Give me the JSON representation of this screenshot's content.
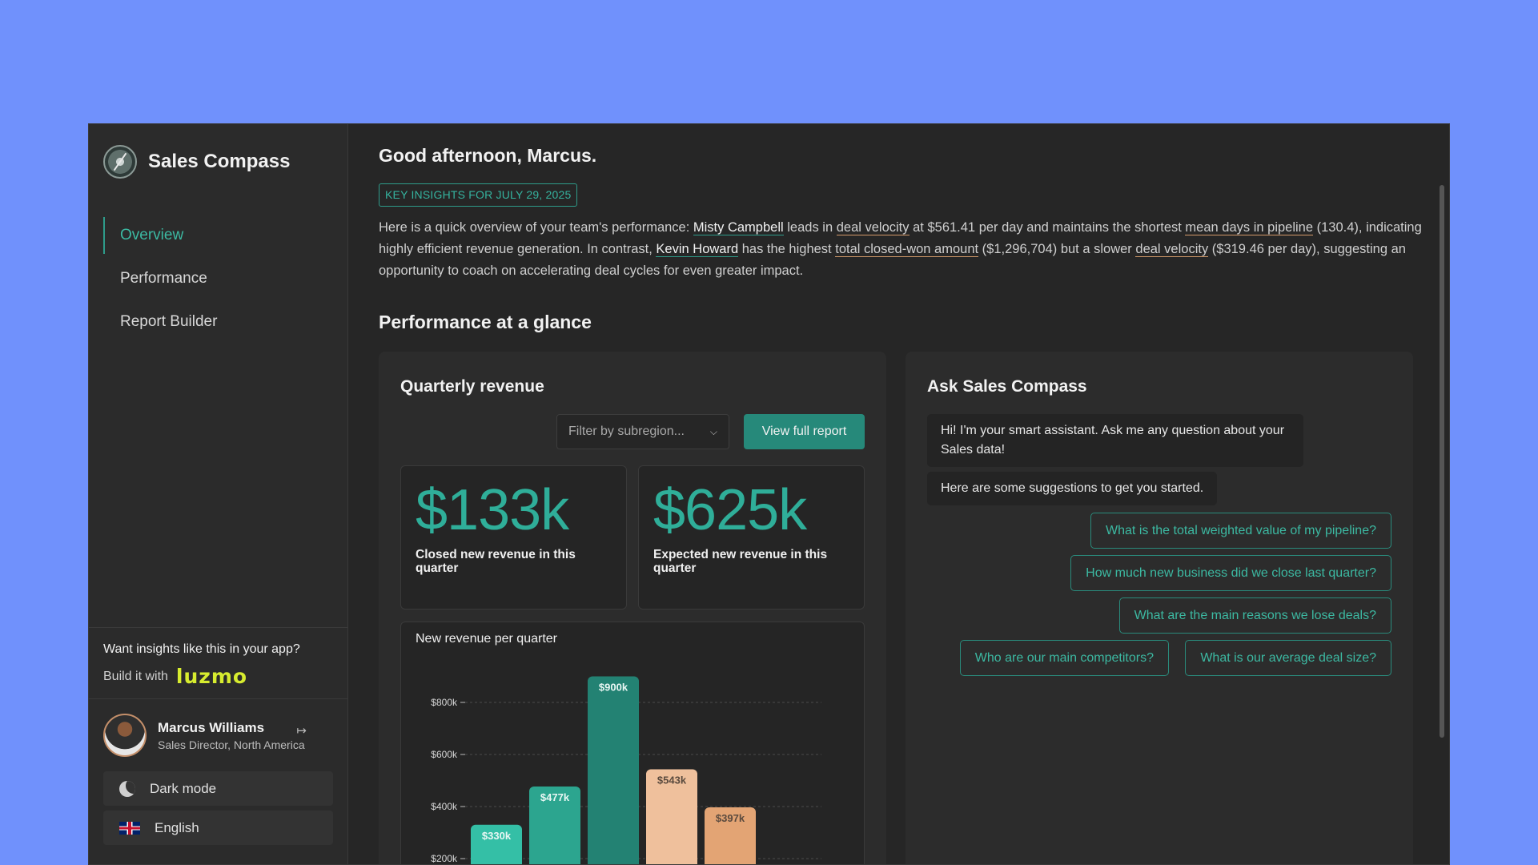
{
  "app": {
    "brand_name": "Sales Compass"
  },
  "sidebar": {
    "nav": [
      {
        "label": "Overview",
        "active": true
      },
      {
        "label": "Performance",
        "active": false
      },
      {
        "label": "Report Builder",
        "active": false
      }
    ],
    "promo_question": "Want insights like this in your app?",
    "promo_build": "Build it with",
    "promo_brand": "luzmo",
    "user": {
      "name": "Marcus Williams",
      "role": "Sales Director, North America"
    },
    "dark_mode_label": "Dark mode",
    "language_label": "English"
  },
  "main": {
    "greeting": "Good afternoon, Marcus.",
    "insights_badge": "KEY INSIGHTS FOR JULY 29, 2025",
    "summary": {
      "p1": "Here is a quick overview of your team's performance: ",
      "name1": "Misty Campbell",
      "p2": " leads in ",
      "m1": "deal velocity",
      "p3": " at $561.41 per day and maintains the shortest ",
      "m2": "mean days in pipeline",
      "p4": " (130.4), indicating highly efficient revenue generation. In contrast, ",
      "name2": "Kevin Howard",
      "p5": " has the highest ",
      "m3": "total closed-won amount",
      "p6": " ($1,296,704) but a slower ",
      "m4": "deal velocity",
      "p7": " ($319.46 per day), suggesting an opportunity to coach on accelerating deal cycles for even greater impact."
    },
    "section_title": "Performance at a glance",
    "revenue_card": {
      "title": "Quarterly revenue",
      "filter_placeholder": "Filter by subregion...",
      "view_report_label": "View full report",
      "kpi_closed_value": "$133k",
      "kpi_closed_label": "Closed new revenue in this quarter",
      "kpi_expected_value": "$625k",
      "kpi_expected_label": "Expected new revenue in this quarter"
    },
    "ask_card": {
      "title": "Ask Sales Compass",
      "greeting_msg": "Hi! I'm your smart assistant. Ask me any question about your Sales data!",
      "suggestions_intro": "Here are some suggestions to get you started.",
      "suggestions": [
        "What is the total weighted value of my pipeline?",
        "How much new business did we close last quarter?",
        "What are the main reasons we lose deals?",
        "Who are our main competitors?",
        "What is our average deal size?"
      ]
    }
  },
  "chart_data": {
    "type": "bar",
    "title": "New revenue per quarter",
    "values": [
      330,
      477,
      900,
      543,
      397
    ],
    "value_labels": [
      "$330k",
      "$477k",
      "$900k",
      "$543k",
      "$397k"
    ],
    "colors": [
      "#34bfa6",
      "#2ca58f",
      "#238273",
      "#efc09c",
      "#e3a474"
    ],
    "y_ticks": [
      200,
      400,
      600,
      800
    ],
    "y_tick_labels": [
      "$200k",
      "$400k",
      "$600k",
      "$800k"
    ],
    "ylim": [
      200,
      900
    ],
    "grid": true
  }
}
